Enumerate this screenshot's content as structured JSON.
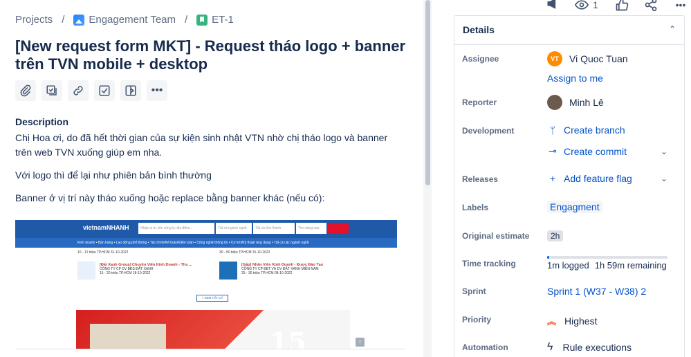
{
  "breadcrumb": {
    "projects": "Projects",
    "separator": "/",
    "project": "Engagement Team",
    "issue_key": "ET-1"
  },
  "issue": {
    "title": "[New request form MKT] - Request tháo logo + banner trên TVN mobile + desktop"
  },
  "toolbar": {
    "icons": [
      "attachment-icon",
      "child-issue-icon",
      "link-icon",
      "checklist-icon",
      "page-icon",
      "more-icon"
    ],
    "more_label": "•••"
  },
  "description": {
    "heading": "Description",
    "paragraph_1": "Chị Hoa ơi, do đã hết thời gian của sự kiện sinh nhật VTN nhờ chị tháo logo và banner trên web TVN xuống  giúp em nha.",
    "paragraph_2": "Với logo thì để lại như phiên bản bình thường",
    "paragraph_3": "Banner ở vị trí này tháo xuống hoặc replace bằng banner khác (nếu có):"
  },
  "embedded_image": {
    "logo_text": "vietnamNHANH",
    "search_placeholder": "Nhập vị trí, tên công ty, địa điểm...",
    "select_industry": "Tất cả ngành nghề",
    "select_location": "Tất cả tỉnh thành",
    "select_more": "Tìm nâng cao",
    "nav_items": "Kinh doanh • Bán hàng • Lao động phổ thông • Tài chính/Kế toán/Kiểm toán • Công nghệ thông tin • Cơ khí/Kỹ thuật ứng dụng • Tất cả các ngành nghề",
    "job_1_meta": "10 - 12 triệu    TP.HCM    31-10-2022",
    "job_2_meta": "30 - 50 triệu    TP.HCM    31-10-2022",
    "job_3_title": "[Đất Xanh Group] Chuyên Viên Kinh Doanh - Thu ...",
    "job_3_company": "CÔNG TY CP DV BĐS ĐẤT XANH",
    "job_3_meta": "15 - 20 triệu    TP.HCM    18-10-2022",
    "job_4_title": "[Gấp] Nhân Viên Kinh Doanh - Được Đào Tạo",
    "job_4_company": "CÔNG TY CP BĐT VÀ DV ĐẤT XANH MIỀN NAM",
    "job_4_meta": "25 - 30 triệu    TP.HCM    08-10-2022",
    "more_button": "+ XEM TẤT CẢ",
    "banner_number": "15"
  },
  "top_actions": {
    "watch_count": "1",
    "more_label": "•••"
  },
  "details": {
    "heading": "Details",
    "assignee_label": "Assignee",
    "assignee_initials": "VT",
    "assignee_name": "Vi Quoc Tuan",
    "assign_to_me": "Assign to me",
    "reporter_label": "Reporter",
    "reporter_name": "Minh Lê",
    "development_label": "Development",
    "create_branch": "Create branch",
    "create_commit": "Create commit",
    "releases_label": "Releases",
    "add_feature_flag": "Add feature flag",
    "labels_label": "Labels",
    "labels_value": "Engagment",
    "original_estimate_label": "Original estimate",
    "original_estimate_value": "2h",
    "time_tracking_label": "Time tracking",
    "time_logged": "1m logged",
    "time_remaining": "1h 59m remaining",
    "time_tracking_fraction": 0.01,
    "sprint_label": "Sprint",
    "sprint_value": "Sprint 1 (W37 - W38) 2",
    "priority_label": "Priority",
    "priority_value": "Highest",
    "automation_label": "Automation",
    "automation_value": "Rule executions"
  },
  "colors": {
    "link": "#0052cc",
    "priority_highest": "#ff5630",
    "assignee_avatar": "#ff8b00"
  }
}
